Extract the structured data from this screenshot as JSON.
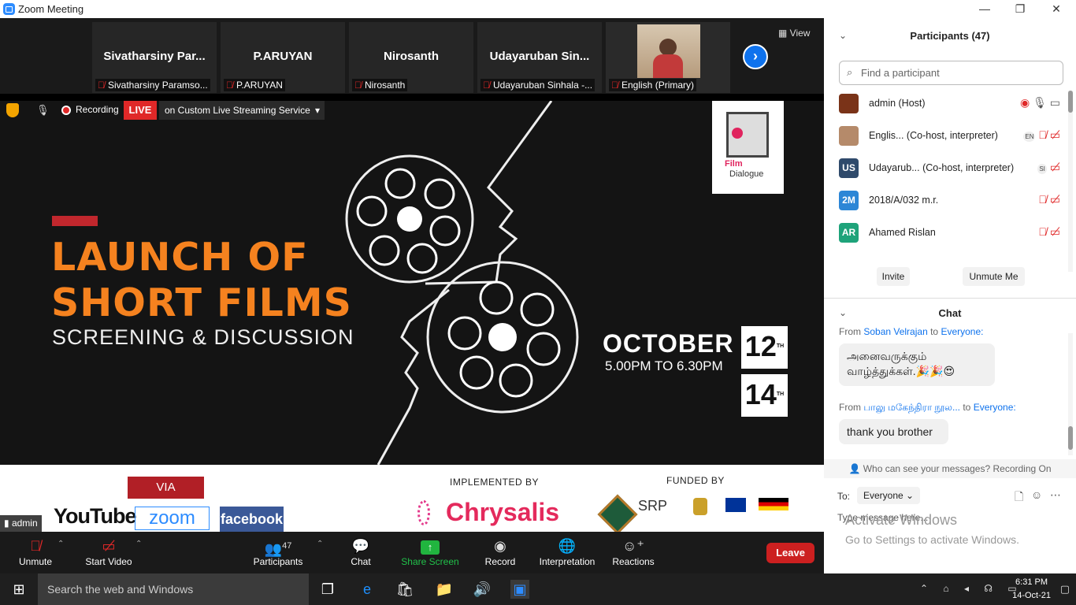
{
  "window": {
    "title": "Zoom Meeting",
    "min": "—",
    "max": "❐",
    "close": "✕"
  },
  "strip": {
    "tiles": [
      {
        "name": "Sivatharsiny  Par...",
        "label": "Sivatharsiny Paramso..."
      },
      {
        "name": "P.ARUYAN",
        "label": "P.ARUYAN"
      },
      {
        "name": "Nirosanth",
        "label": "Nirosanth"
      },
      {
        "name": "Udayaruban  Sin...",
        "label": "Udayaruban Sinhala -..."
      },
      {
        "name": "",
        "label": "English (Primary)"
      }
    ],
    "view": "View"
  },
  "status": {
    "recording": "Recording",
    "live": "LIVE",
    "stream": "on Custom Live Streaming Service"
  },
  "slide": {
    "line1": "LAUNCH OF",
    "line2": "SHORT FILMS",
    "line3": "SCREENING & DISCUSSION",
    "month": "OCTOBER",
    "day1": "12",
    "day2": "14",
    "th": "TH",
    "time": "5.00PM TO 6.30PM",
    "logo_top": "Film",
    "logo_bottom": "Dialogue",
    "via": "VIA",
    "youtube": "YouTube",
    "zoom": "zoom",
    "facebook": "facebook",
    "implemented": "IMPLEMENTED BY",
    "chrysalis": "Chrysalis",
    "funded": "FUNDED BY",
    "srp": "SRP"
  },
  "self_label": "admin",
  "toolbar": {
    "unmute": "Unmute",
    "start_video": "Start Video",
    "participants": "Participants",
    "participants_count": "47",
    "chat": "Chat",
    "share_screen": "Share Screen",
    "record": "Record",
    "interpretation": "Interpretation",
    "reactions": "Reactions",
    "leave": "Leave"
  },
  "panel": {
    "participants_title": "Participants (47)",
    "search_placeholder": "Find a participant",
    "participants": [
      {
        "initials": "",
        "name": "admin (Host)",
        "color": "#7a3318"
      },
      {
        "initials": "",
        "name": "Englis...  (Co-host, interpreter)",
        "chip": "EN",
        "color": "#b58a6a"
      },
      {
        "initials": "US",
        "name": "Udayarub...  (Co-host, interpreter)",
        "chip": "SI",
        "color": "#2f4a6b"
      },
      {
        "initials": "2M",
        "name": "2018/A/032 m.r.",
        "color": "#2c86d6"
      },
      {
        "initials": "AR",
        "name": "Ahamed Rislan",
        "color": "#1ea37a"
      }
    ],
    "invite": "Invite",
    "unmute_me": "Unmute Me",
    "chat_title": "Chat",
    "messages": [
      {
        "from_prefix": "From",
        "from": "Soban Velrajan",
        "to_prefix": "to",
        "to": "Everyone:",
        "text1": "அனைவருக்கும்",
        "text2": "வாழ்த்துக்கள்.🎉🎉😍"
      },
      {
        "from_prefix": "From",
        "from": "பாலு மகேந்திரா நூல...",
        "to_prefix": "to",
        "to": "Everyone:",
        "text1": "thank you brother"
      }
    ],
    "privacy": "Who can see your messages? Recording On",
    "to_label": "To:",
    "to_value": "Everyone",
    "message_placeholder": "Type message here...",
    "watermark1": "Activate Windows",
    "watermark2": "Go to Settings to activate Windows."
  },
  "taskbar": {
    "search": "Search the web and Windows",
    "time": "6:31 PM",
    "date": "14-Oct-21"
  }
}
